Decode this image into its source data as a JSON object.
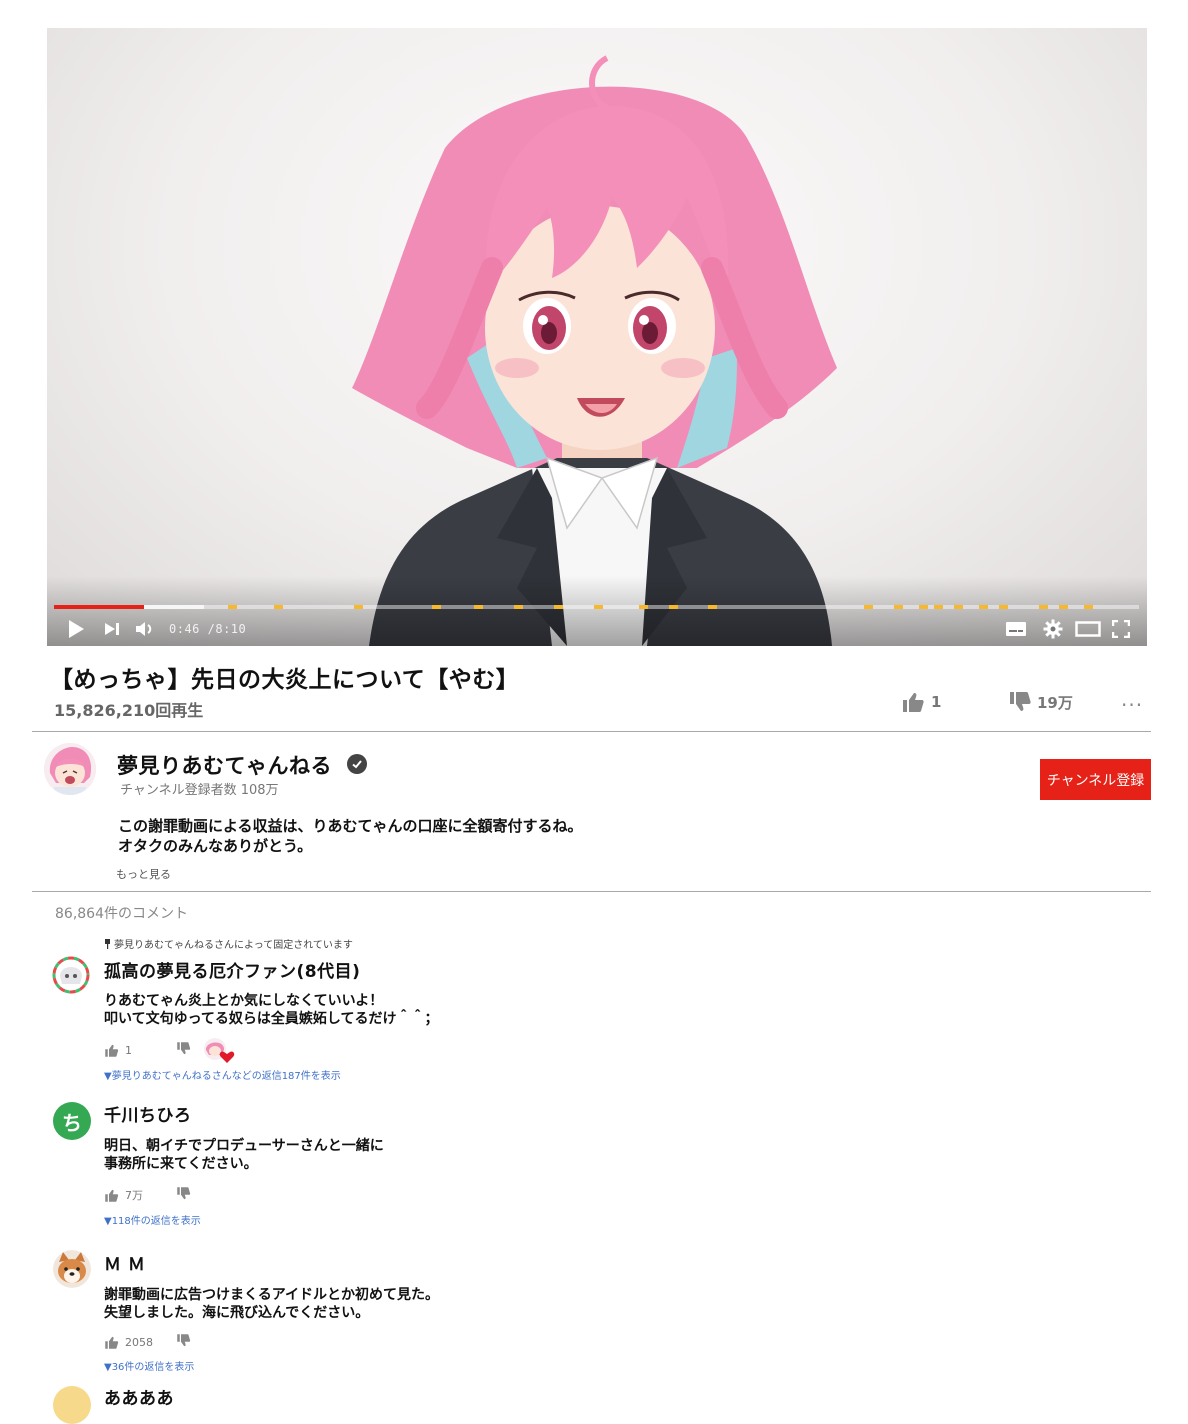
{
  "player": {
    "current_time": "0:46",
    "duration": "8:10",
    "progress_fraction": 0.083,
    "buffered_fraction": 0.138,
    "colors": {
      "played": "#e62117",
      "ad_marker": "#f5b82e"
    },
    "icons": [
      "play-icon",
      "next-icon",
      "volume-icon",
      "subtitles-icon",
      "settings-icon",
      "theater-mode-icon",
      "fullscreen-icon"
    ]
  },
  "video": {
    "title": "【めっちゃ】先日の大炎上について【やむ】",
    "views": "15,826,210回再生",
    "likes": "1",
    "dislikes": "19万",
    "more": "···"
  },
  "channel": {
    "name": "夢見りあむてゃんねる",
    "subscribers": "チャンネル登録者数 108万",
    "subscribe_label": "チャンネル登録",
    "description_line1": "この謝罪動画による収益は、りあむてゃんの口座に全額寄付するね。",
    "description_line2": "オタクのみんなありがとう。",
    "show_more": "もっと見る"
  },
  "comments_section": {
    "count": "86,864件のコメント",
    "pinned_note": "夢見りあむてゃんねるさんによって固定されています",
    "comments": [
      {
        "author": "孤高の夢見る厄介ファン(8代目)",
        "body": "りあむてゃん炎上とか気にしなくていいよ！\n叩いて文句ゆってる奴らは全員嫉妬してるだけ＾＾；",
        "likes": "1",
        "replies": "▼夢見りあむてゃんねるさんなどの返信187件を表示"
      },
      {
        "author": "千川ちひろ",
        "avatar_letter": "ち",
        "body": "明日、朝イチでプロデューサーさんと一緒に\n事務所に来てください。",
        "likes": "7万",
        "replies": "▼118件の返信を表示"
      },
      {
        "author": "Ｍ Ｍ",
        "body": "謝罪動画に広告つけまくるアイドルとか初めて見た。\n失望しました。海に飛び込んでください。",
        "likes": "2058",
        "replies": "▼36件の返信を表示"
      },
      {
        "author": "ああああ"
      }
    ]
  }
}
